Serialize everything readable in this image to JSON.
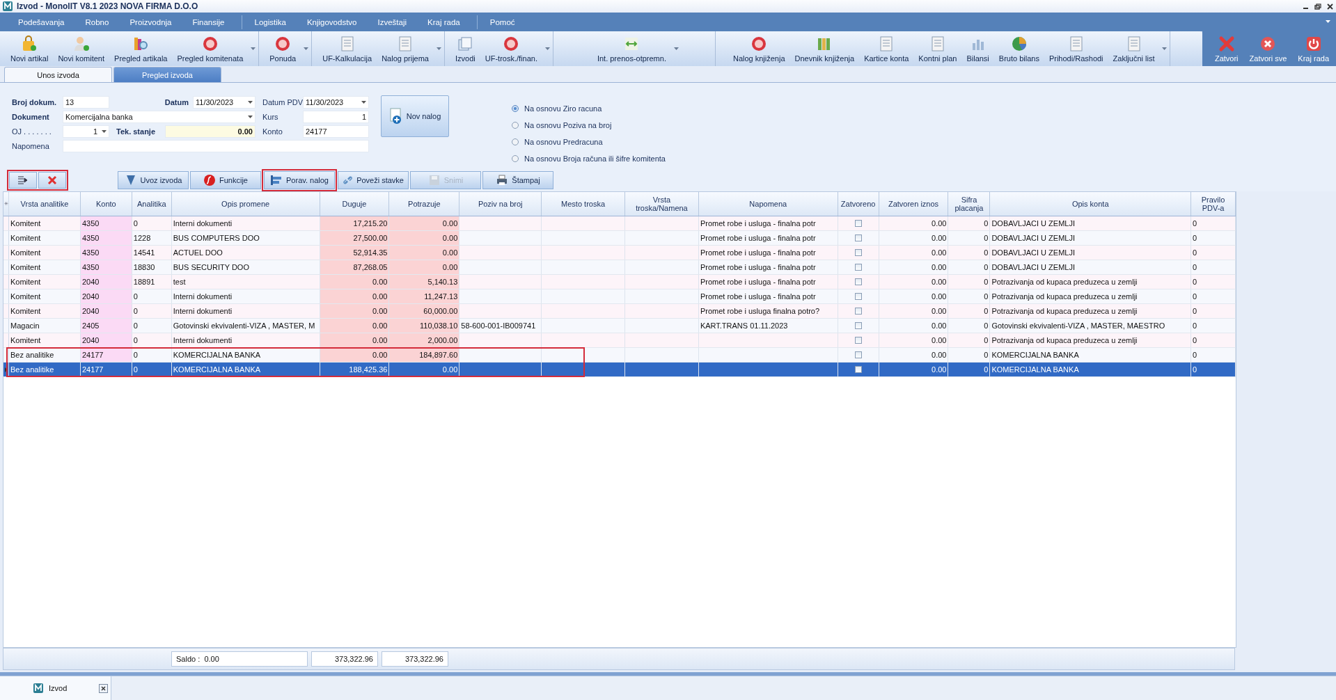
{
  "window": {
    "title": "Izvod - MonolIT V8.1 2023 NOVA FIRMA D.O.O"
  },
  "menu": [
    "Podešavanja",
    "Robno",
    "Proizvodnja",
    "Finansije",
    "Logistika",
    "Knjigovodstvo",
    "Izveštaji",
    "Kraj rada",
    "Pomoć"
  ],
  "toolbar": {
    "groups": [
      {
        "has_menu": true,
        "items": [
          "Novi artikal",
          "Novi komitent",
          "Pregled artikala",
          "Pregled komitenata"
        ]
      },
      {
        "has_menu": true,
        "items": [
          "Ponuda"
        ]
      },
      {
        "has_menu": true,
        "items": [
          "UF-Kalkulacija",
          "Nalog prijema"
        ]
      },
      {
        "has_menu": true,
        "items": [
          "Izvodi",
          "UF-trosk./finan."
        ]
      },
      {
        "has_menu": true,
        "items": [
          "Int. prenos-otpremn."
        ]
      },
      {
        "has_menu": true,
        "items": [
          "Nalog knjiženja",
          "Dnevnik knjiženja",
          "Kartice konta",
          "Kontni plan",
          "Bilansi",
          "Bruto bilans",
          "Prihodi/Rashodi",
          "Zaključni list"
        ]
      }
    ],
    "window_actions": [
      "Zatvori",
      "Zatvori sve",
      "Kraj rada"
    ]
  },
  "tabs": [
    {
      "label": "Unos izvoda",
      "selected": true
    },
    {
      "label": "Pregled izvoda",
      "selected": false
    }
  ],
  "form": {
    "broj_label": "Broj dokum.",
    "broj": "13",
    "datum_label": "Datum",
    "datum": "11/30/2023",
    "datum_pdv_label": "Datum PDV",
    "datum_pdv": "11/30/2023",
    "dokument_label": "Dokument",
    "dokument": "Komercijalna banka",
    "kurs_label": "Kurs",
    "kurs": "1",
    "oj_label": "OJ . . . . . . .",
    "oj": "1",
    "tek_stanje_label": "Tek. stanje",
    "tek_stanje": "0.00",
    "konto_label": "Konto",
    "konto": "24177",
    "napomena_label": "Napomena",
    "new_button": "Nov nalog"
  },
  "options": [
    {
      "label": "Na osnovu Ziro racuna",
      "selected": true
    },
    {
      "label": "Na osnovu Poziva na broj",
      "selected": false
    },
    {
      "label": "Na osnovu Predracuna",
      "selected": false
    },
    {
      "label": "Na osnovu Broja računa ili šifre komitenta",
      "selected": false
    }
  ],
  "actions": [
    {
      "label": "Uvoz izvoda",
      "disabled": false,
      "framed": false
    },
    {
      "label": "Funkcije",
      "disabled": false,
      "framed": false
    },
    {
      "label": "Porav. nalog",
      "disabled": false,
      "framed": true
    },
    {
      "label": "Poveži stavke",
      "disabled": false,
      "framed": false
    },
    {
      "label": "Snimi",
      "disabled": true,
      "framed": false
    },
    {
      "label": "Štampaj",
      "disabled": false,
      "framed": false
    }
  ],
  "table": {
    "new_row_mark": "✳",
    "columns": [
      {
        "label": "Vrsta analitike",
        "kind": "text"
      },
      {
        "label": "Konto",
        "kind": "konto"
      },
      {
        "label": "Analitika",
        "kind": "text"
      },
      {
        "label": "Opis promene",
        "kind": "text"
      },
      {
        "label": "Duguje",
        "kind": "amount"
      },
      {
        "label": "Potrazuje",
        "kind": "amount"
      },
      {
        "label": "Poziv na broj",
        "kind": "text"
      },
      {
        "label": "Mesto troska",
        "kind": "text"
      },
      {
        "label": "Vrsta troska/Namena",
        "kind": "text"
      },
      {
        "label": "Napomena",
        "kind": "text"
      },
      {
        "label": "Zatvoreno",
        "kind": "checkbox"
      },
      {
        "label": "Zatvoren iznos",
        "kind": "number"
      },
      {
        "label": "Sifra placanja",
        "kind": "number"
      },
      {
        "label": "Opis konta",
        "kind": "text"
      },
      {
        "label": "Pravilo PDV-a",
        "kind": "text"
      }
    ],
    "rows": [
      {
        "selected": false,
        "cells": [
          "Komitent",
          "4350",
          "0",
          "Interni dokumenti",
          "17,215.20",
          "0.00",
          null,
          null,
          null,
          "Promet robe i usluga - finalna potr",
          false,
          "0.00",
          "0",
          "DOBAVLJACI U ZEMLJI",
          "0"
        ]
      },
      {
        "selected": false,
        "cells": [
          "Komitent",
          "4350",
          "1228",
          "BUS COMPUTERS DOO",
          "27,500.00",
          "0.00",
          null,
          null,
          null,
          "Promet robe i usluga - finalna potr",
          false,
          "0.00",
          "0",
          "DOBAVLJACI U ZEMLJI",
          "0"
        ]
      },
      {
        "selected": false,
        "cells": [
          "Komitent",
          "4350",
          "14541",
          "ACTUEL DOO",
          "52,914.35",
          "0.00",
          null,
          null,
          null,
          "Promet robe i usluga - finalna potr",
          false,
          "0.00",
          "0",
          "DOBAVLJACI U ZEMLJI",
          "0"
        ]
      },
      {
        "selected": false,
        "cells": [
          "Komitent",
          "4350",
          "18830",
          "BUS SECURITY DOO",
          "87,268.05",
          "0.00",
          null,
          null,
          null,
          "Promet robe i usluga - finalna potr",
          false,
          "0.00",
          "0",
          "DOBAVLJACI U ZEMLJI",
          "0"
        ]
      },
      {
        "selected": false,
        "cells": [
          "Komitent",
          "2040",
          "18891",
          "test",
          "0.00",
          "5,140.13",
          null,
          null,
          null,
          "Promet robe i usluga - finalna potr",
          false,
          "0.00",
          "0",
          "Potrazivanja od kupaca preduzeca u zemlji",
          "0"
        ]
      },
      {
        "selected": false,
        "cells": [
          "Komitent",
          "2040",
          "0",
          "Interni dokumenti",
          "0.00",
          "11,247.13",
          null,
          null,
          null,
          "Promet robe i usluga - finalna potr",
          false,
          "0.00",
          "0",
          "Potrazivanja od kupaca preduzeca u zemlji",
          "0"
        ]
      },
      {
        "selected": false,
        "cells": [
          "Komitent",
          "2040",
          "0",
          "Interni dokumenti",
          "0.00",
          "60,000.00",
          null,
          null,
          null,
          "Promet robe i usluga finalna potro?",
          false,
          "0.00",
          "0",
          "Potrazivanja od kupaca preduzeca u zemlji",
          "0"
        ]
      },
      {
        "selected": false,
        "cells": [
          "Magacin",
          "2405",
          "0",
          "Gotovinski ekvivalenti-VIZA , MASTER, M",
          "0.00",
          "110,038.10",
          "58-600-001-IB009741",
          null,
          null,
          "KART.TRANS 01.11.2023",
          false,
          "0.00",
          "0",
          "Gotovinski ekvivalenti-VIZA , MASTER, MAESTRO",
          "0"
        ]
      },
      {
        "selected": false,
        "cells": [
          "Komitent",
          "2040",
          "0",
          "Interni dokumenti",
          "0.00",
          "2,000.00",
          null,
          null,
          null,
          null,
          false,
          "0.00",
          "0",
          "Potrazivanja od kupaca preduzeca u zemlji",
          "0"
        ]
      },
      {
        "selected": false,
        "cells": [
          "Bez analitike",
          "24177",
          "0",
          "KOMERCIJALNA BANKA",
          "0.00",
          "184,897.60",
          null,
          null,
          null,
          null,
          false,
          "0.00",
          "0",
          "KOMERCIJALNA BANKA",
          "0"
        ]
      },
      {
        "selected": true,
        "cells": [
          "Bez analitike",
          "24177",
          "0",
          "KOMERCIJALNA BANKA",
          "188,425.36",
          "0.00",
          null,
          null,
          null,
          null,
          false,
          "0.00",
          "0",
          "KOMERCIJALNA BANKA",
          "0"
        ]
      }
    ]
  },
  "footer": {
    "saldo_label": "Saldo :",
    "saldo": "0.00",
    "duguje_total": "373,322.96",
    "potrazuje_total": "373,322.96"
  },
  "bottom_tabs": [
    {
      "label": "Izvod",
      "selected": true
    }
  ]
}
